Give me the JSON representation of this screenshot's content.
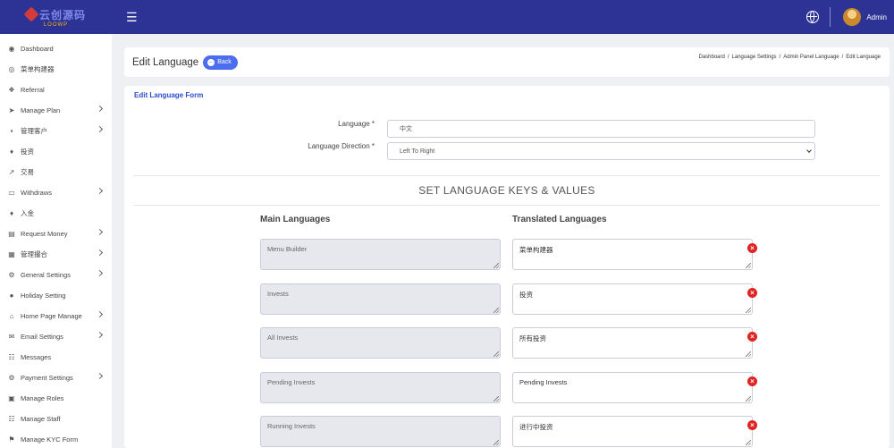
{
  "brand": {
    "logo_text": "云创源码",
    "logo_sub": "LOOWP"
  },
  "topbar": {
    "admin_name": "Admin"
  },
  "sidebar": {
    "items": [
      {
        "label": "Dashboard",
        "icon": "dashboard-icon",
        "has_submenu": false
      },
      {
        "label": "菜单构建器",
        "icon": "menu-builder-icon",
        "has_submenu": false
      },
      {
        "label": "Referral",
        "icon": "referral-icon",
        "has_submenu": false
      },
      {
        "label": "Manage Plan",
        "icon": "plan-icon",
        "has_submenu": true
      },
      {
        "label": "管理客户",
        "icon": "user-icon",
        "has_submenu": true
      },
      {
        "label": "投资",
        "icon": "invest-icon",
        "has_submenu": false
      },
      {
        "label": "交易",
        "icon": "chart-icon",
        "has_submenu": false
      },
      {
        "label": "Withdraws",
        "icon": "withdraw-icon",
        "has_submenu": true
      },
      {
        "label": "入金",
        "icon": "deposit-icon",
        "has_submenu": false
      },
      {
        "label": "Request Money",
        "icon": "request-money-icon",
        "has_submenu": true
      },
      {
        "label": "管理撮合",
        "icon": "match-icon",
        "has_submenu": true
      },
      {
        "label": "General Settings",
        "icon": "settings-icon",
        "has_submenu": true
      },
      {
        "label": "Holiday Setting",
        "icon": "holiday-icon",
        "has_submenu": false
      },
      {
        "label": "Home Page Manage",
        "icon": "home-page-icon",
        "has_submenu": true
      },
      {
        "label": "Email Settings",
        "icon": "email-icon",
        "has_submenu": true
      },
      {
        "label": "Messages",
        "icon": "messages-icon",
        "has_submenu": false
      },
      {
        "label": "Payment Settings",
        "icon": "payment-icon",
        "has_submenu": true
      },
      {
        "label": "Manage Roles",
        "icon": "roles-icon",
        "has_submenu": false
      },
      {
        "label": "Manage Staff",
        "icon": "staff-icon",
        "has_submenu": false
      },
      {
        "label": "Manage KYC Form",
        "icon": "kyc-icon",
        "has_submenu": false
      }
    ]
  },
  "header": {
    "title": "Edit Language",
    "back_label": "Back",
    "breadcrumb": [
      "Dashboard",
      "Language Settings",
      "Admin Panel Language",
      "Edit Language"
    ]
  },
  "form": {
    "heading": "Edit Language Form",
    "language_label": "Language *",
    "language_value": "中文",
    "direction_label": "Language Direction *",
    "direction_value": "Left To Right",
    "section_title": "SET LANGUAGE KEYS & VALUES",
    "col_main": "Main Languages",
    "col_translated": "Translated Languages",
    "rows": [
      {
        "key": "Menu Builder",
        "value": "菜单构建器"
      },
      {
        "key": "Invests",
        "value": "投资"
      },
      {
        "key": "All Invests",
        "value": "所有投资"
      },
      {
        "key": "Pending Invests",
        "value": "Pending Invests"
      },
      {
        "key": "Running Invests",
        "value": "进行中投资"
      }
    ]
  },
  "colors": {
    "topbar": "#2c3394",
    "accent": "#4b6ef0",
    "delete": "#e02424",
    "heading": "#2a4bd1"
  }
}
